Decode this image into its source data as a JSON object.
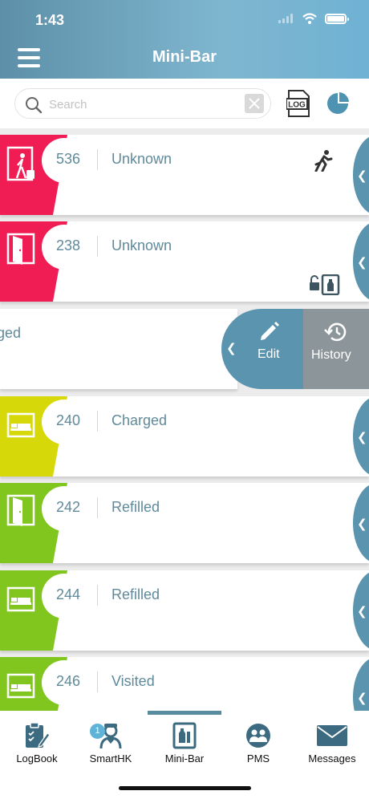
{
  "status_bar": {
    "time": "1:43"
  },
  "header": {
    "title": "Mini-Bar"
  },
  "search": {
    "placeholder": "Search",
    "value": ""
  },
  "toolbar": {
    "log_label": "LOG"
  },
  "colors": {
    "header": "#6fa8c4",
    "red": "#f01d55",
    "yellow": "#d6d80a",
    "green": "#80c61f",
    "accent": "#5a94ae",
    "history": "#8c969a"
  },
  "rooms": [
    {
      "number": "536",
      "status": "Unknown",
      "color": "red",
      "room_icon": "guest-luggage-icon",
      "extra_icon": "running-person-icon"
    },
    {
      "number": "238",
      "status": "Unknown",
      "color": "red",
      "room_icon": "open-door-icon",
      "extra_icon": "unlocked-minibar-icon"
    },
    {
      "number": "240",
      "status": "Charged",
      "color": "yellow",
      "room_icon": "bed-icon"
    },
    {
      "number": "242",
      "status": "Refilled",
      "color": "green",
      "room_icon": "open-door-icon"
    },
    {
      "number": "244",
      "status": "Refilled",
      "color": "green",
      "room_icon": "bed-icon"
    },
    {
      "number": "246",
      "status": "Visited",
      "color": "green",
      "room_icon": "bed-icon"
    }
  ],
  "swiped_row": {
    "status_partial": "arged",
    "actions": {
      "edit": "Edit",
      "history": "History"
    }
  },
  "nav": {
    "items": [
      {
        "label": "LogBook",
        "icon": "logbook-icon"
      },
      {
        "label": "SmartHK",
        "icon": "housekeeper-icon",
        "badge": "1"
      },
      {
        "label": "Mini-Bar",
        "icon": "minibar-icon",
        "active": true
      },
      {
        "label": "PMS",
        "icon": "people-icon"
      },
      {
        "label": "Messages",
        "icon": "envelope-icon"
      }
    ]
  }
}
